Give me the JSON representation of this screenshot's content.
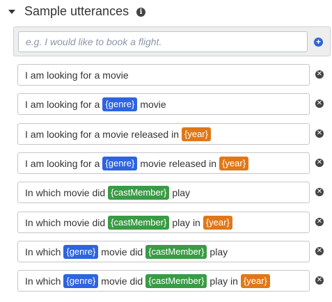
{
  "section": {
    "title": "Sample utterances",
    "info_icon_glyph": "i",
    "expand_icon": "caret-down-icon"
  },
  "new_utterance": {
    "placeholder": "e.g. I would like to book a flight.",
    "value": "",
    "add_icon": "plus-circle-icon"
  },
  "slot_colors": {
    "genre": "#2e64e0",
    "year": "#e07818",
    "castMember": "#3a9b45"
  },
  "utterances": [
    {
      "parts": [
        {
          "text": "I am looking for a movie"
        }
      ]
    },
    {
      "parts": [
        {
          "text": "I am looking for a "
        },
        {
          "slot": "genre",
          "text": "{genre}"
        },
        {
          "text": " movie"
        }
      ]
    },
    {
      "parts": [
        {
          "text": "I am looking for a movie released in "
        },
        {
          "slot": "year",
          "text": "{year}"
        }
      ]
    },
    {
      "parts": [
        {
          "text": "I am looking for a "
        },
        {
          "slot": "genre",
          "text": "{genre}"
        },
        {
          "text": " movie released in "
        },
        {
          "slot": "year",
          "text": "{year}"
        }
      ]
    },
    {
      "parts": [
        {
          "text": "In which movie did "
        },
        {
          "slot": "castMember",
          "text": "{castMember}"
        },
        {
          "text": " play"
        }
      ]
    },
    {
      "parts": [
        {
          "text": "In which movie did "
        },
        {
          "slot": "castMember",
          "text": "{castMember}"
        },
        {
          "text": " play in "
        },
        {
          "slot": "year",
          "text": "{year}"
        }
      ]
    },
    {
      "parts": [
        {
          "text": "In which "
        },
        {
          "slot": "genre",
          "text": "{genre}"
        },
        {
          "text": " movie did "
        },
        {
          "slot": "castMember",
          "text": "{castMember}"
        },
        {
          "text": " play"
        }
      ]
    },
    {
      "parts": [
        {
          "text": "In which "
        },
        {
          "slot": "genre",
          "text": "{genre}"
        },
        {
          "text": " movie did "
        },
        {
          "slot": "castMember",
          "text": "{castMember}"
        },
        {
          "text": " play in "
        },
        {
          "slot": "year",
          "text": "{year}"
        }
      ]
    }
  ],
  "delete_icon": "close-circle-icon",
  "delete_glyph": "✕"
}
